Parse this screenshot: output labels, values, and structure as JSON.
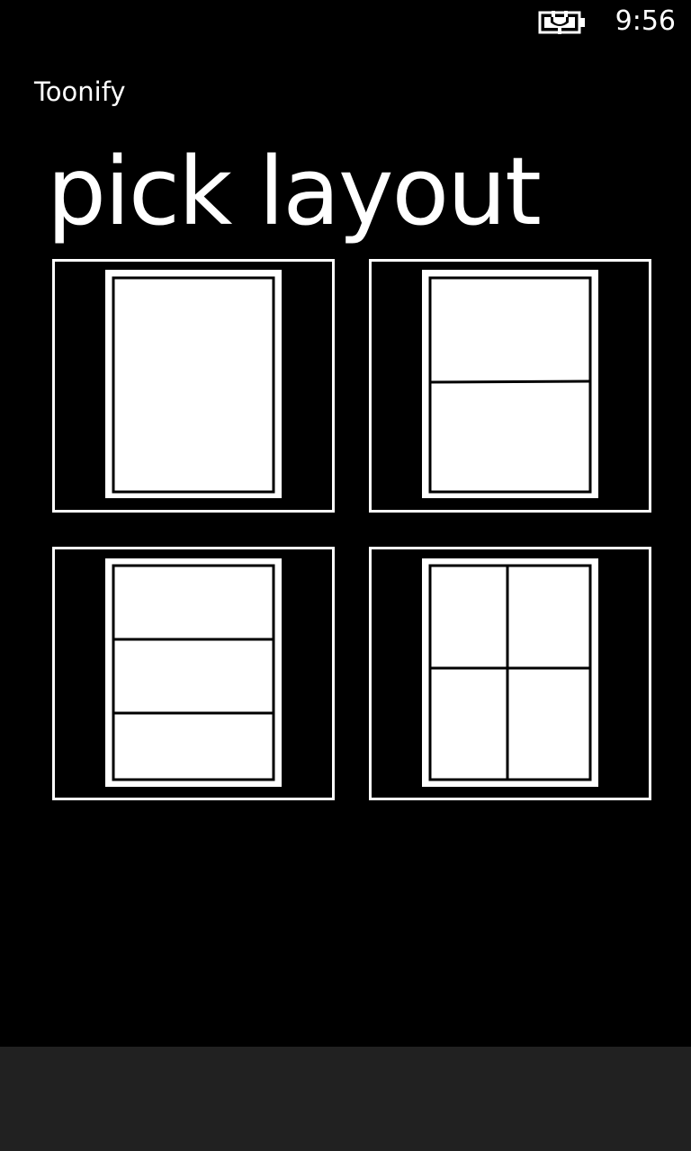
{
  "status_bar": {
    "time": "9:56",
    "battery_icon": "battery-charging-icon"
  },
  "app": {
    "title": "Toonify"
  },
  "page": {
    "title": "pick layout"
  },
  "layouts": [
    {
      "id": "single-panel",
      "icon": "layout-1-panel-icon",
      "rows": 1,
      "columns": 1
    },
    {
      "id": "two-rows",
      "icon": "layout-2-rows-icon",
      "rows": 2,
      "columns": 1
    },
    {
      "id": "three-rows",
      "icon": "layout-3-rows-icon",
      "rows": 3,
      "columns": 1
    },
    {
      "id": "grid-2x2",
      "icon": "layout-2x2-grid-icon",
      "rows": 2,
      "columns": 2
    }
  ],
  "colors": {
    "background": "#000000",
    "foreground": "#ffffff",
    "app_bar": "#212121"
  }
}
